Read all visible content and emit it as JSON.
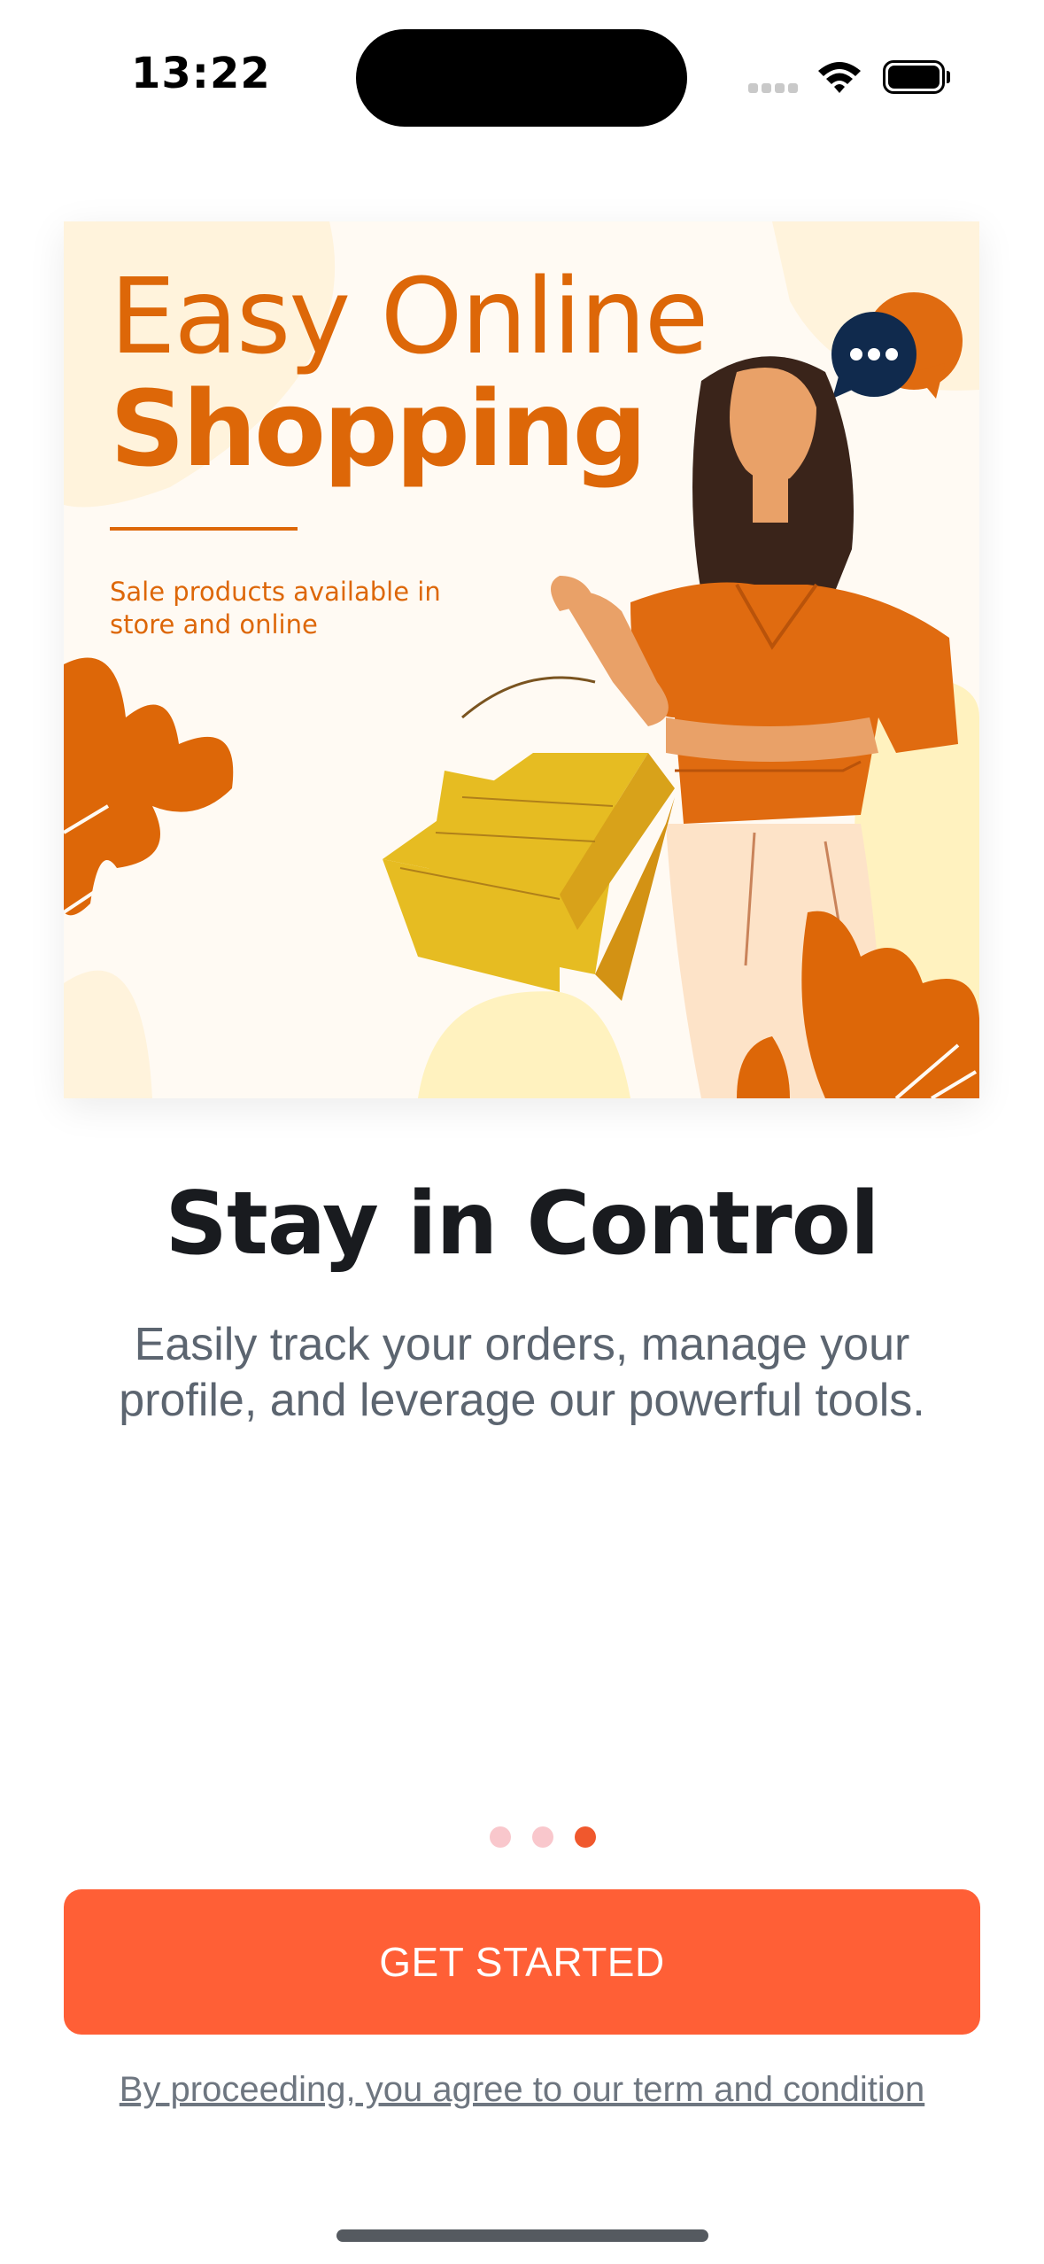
{
  "status_bar": {
    "time": "13:22"
  },
  "hero": {
    "headline_light": "Easy Online",
    "headline_bold": "Shopping",
    "subtext": "Sale products available in store and online",
    "colors": {
      "accent": "#dd6708",
      "background": "#fffaf3",
      "bubble_navy": "#102a4d"
    },
    "illustration": "woman-with-shopping-bags"
  },
  "onboarding": {
    "title": "Stay in Control",
    "description": "Easily track your orders, manage your profile, and leverage our powerful tools.",
    "pager": {
      "count": 3,
      "active_index": 2
    }
  },
  "actions": {
    "get_started": "GET STARTED",
    "terms": "By proceeding, you agree to our term and condition"
  },
  "colors": {
    "primary": "#ff5f36",
    "title": "#191b1f",
    "body": "#5c6570",
    "dot_inactive": "#f9c7cc",
    "dot_active": "#f0582d"
  }
}
